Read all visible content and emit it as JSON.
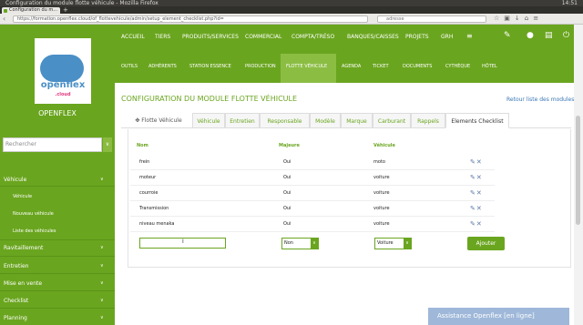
{
  "browser": {
    "window_title": "Configuration du module flotte véhicule - Mozilla Firefox",
    "tab_title": "Configuration du m...",
    "new_tab": "+",
    "url": "https://formation.openflex.cloud/of_flottevehicule/admin/setup_element_checklist.php?id=",
    "search_placeholder": "adresse",
    "system_tray": "14:51"
  },
  "sidebar": {
    "logo_word": "openflex",
    "logo_suffix": ".cloud",
    "brand": "OPENFLEX",
    "search_placeholder": "Rechercher",
    "search_button": "∨",
    "items": [
      {
        "label": "Véhicule",
        "chev": "∨"
      },
      {
        "label": "Véhicule"
      },
      {
        "label": "Nouveau véhicule"
      },
      {
        "label": "Liste des véhicules"
      },
      {
        "label": "Ravitaillement",
        "chev": "∨"
      },
      {
        "label": "Entretien",
        "chev": "∨"
      },
      {
        "label": "Mise en vente",
        "chev": "∨"
      },
      {
        "label": "Checklist",
        "chev": "∨"
      },
      {
        "label": "Planning",
        "chev": "∨"
      }
    ]
  },
  "topnav": [
    "ACCUEIL",
    "TIERS",
    "PRODUITS/SERVICES",
    "COMMERCIAL",
    "COMPTA/TRÉSO",
    "BANQUES/CAISSES",
    "PROJETS",
    "GRH",
    "≡"
  ],
  "subnav": [
    "OUTILS",
    "ADHÉRENTS",
    "STATION ESSENCE",
    "PRODUCTION",
    "FLOTTE VÉHICULE",
    "AGENDA",
    "TICKET",
    "DOCUMENTS",
    "CYTHÈQUE",
    "HÔTEL"
  ],
  "page": {
    "title": "CONFIGURATION DU MODULE FLOTTE VÉHICULE",
    "back_link": "Retour liste des modules"
  },
  "tabs": [
    "Flotte Véhicule",
    "Véhicule",
    "Entretien",
    "Responsable",
    "Modèle",
    "Marque",
    "Carburant",
    "Rappels",
    "Elements Checklist"
  ],
  "table": {
    "headers": [
      "Nom",
      "Majeure",
      "Véhicule"
    ],
    "rows": [
      [
        "frein",
        "Oui",
        "moto"
      ],
      [
        "moteur",
        "Oui",
        "voiture"
      ],
      [
        "courroie",
        "Oui",
        "voiture"
      ],
      [
        "Transmission",
        "Oui",
        "voiture"
      ],
      [
        "niveau menaka",
        "Oui",
        "voiture"
      ]
    ],
    "new_row": {
      "majeure": "Non",
      "vehicule": "Voiture",
      "add_label": "Ajouter"
    }
  },
  "assist": "Assistance Openflex [en ligne]",
  "colors": {
    "brand_green": "#6aa51f",
    "link_blue": "#3a76b5"
  }
}
